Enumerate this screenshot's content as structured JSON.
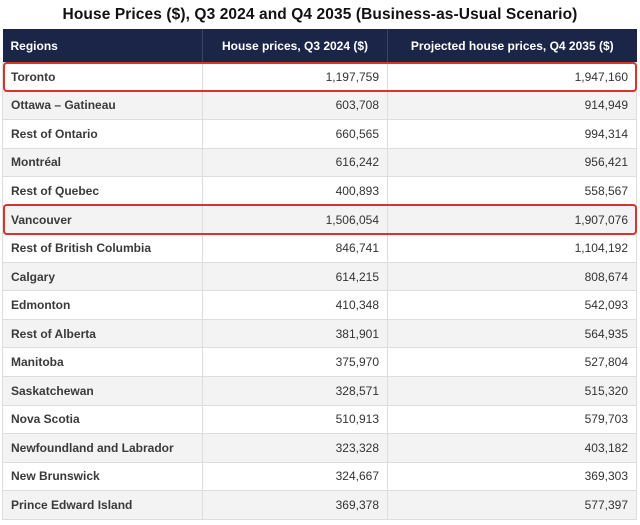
{
  "chart_data": {
    "type": "table",
    "title": "House Prices ($), Q3 2024 and Q4 2035 (Business-as-Usual Scenario)",
    "columns": [
      "Regions",
      "House prices, Q3 2024 ($)",
      "Projected house prices, Q4 2035 ($)"
    ],
    "rows": [
      {
        "region": "Toronto",
        "q3_2024": "1,197,759",
        "q4_2035": "1,947,160",
        "highlighted": true
      },
      {
        "region": "Ottawa – Gatineau",
        "q3_2024": "603,708",
        "q4_2035": "914,949",
        "highlighted": false
      },
      {
        "region": "Rest of Ontario",
        "q3_2024": "660,565",
        "q4_2035": "994,314",
        "highlighted": false
      },
      {
        "region": "Montréal",
        "q3_2024": "616,242",
        "q4_2035": "956,421",
        "highlighted": false
      },
      {
        "region": "Rest of Quebec",
        "q3_2024": "400,893",
        "q4_2035": "558,567",
        "highlighted": false
      },
      {
        "region": "Vancouver",
        "q3_2024": "1,506,054",
        "q4_2035": "1,907,076",
        "highlighted": true
      },
      {
        "region": "Rest of British Columbia",
        "q3_2024": "846,741",
        "q4_2035": "1,104,192",
        "highlighted": false
      },
      {
        "region": "Calgary",
        "q3_2024": "614,215",
        "q4_2035": "808,674",
        "highlighted": false
      },
      {
        "region": "Edmonton",
        "q3_2024": "410,348",
        "q4_2035": "542,093",
        "highlighted": false
      },
      {
        "region": "Rest of Alberta",
        "q3_2024": "381,901",
        "q4_2035": "564,935",
        "highlighted": false
      },
      {
        "region": "Manitoba",
        "q3_2024": "375,970",
        "q4_2035": "527,804",
        "highlighted": false
      },
      {
        "region": "Saskatchewan",
        "q3_2024": "328,571",
        "q4_2035": "515,320",
        "highlighted": false
      },
      {
        "region": "Nova Scotia",
        "q3_2024": "510,913",
        "q4_2035": "579,703",
        "highlighted": false
      },
      {
        "region": "Newfoundland and Labrador",
        "q3_2024": "323,328",
        "q4_2035": "403,182",
        "highlighted": false
      },
      {
        "region": "New Brunswick",
        "q3_2024": "324,667",
        "q4_2035": "369,303",
        "highlighted": false
      },
      {
        "region": "Prince Edward Island",
        "q3_2024": "369,378",
        "q4_2035": "577,397",
        "highlighted": false
      }
    ],
    "colors": {
      "header_bg": "#1b2548",
      "header_text": "#ffffff",
      "highlight": "#d9342b",
      "row_alt": "#f3f3f3"
    }
  }
}
